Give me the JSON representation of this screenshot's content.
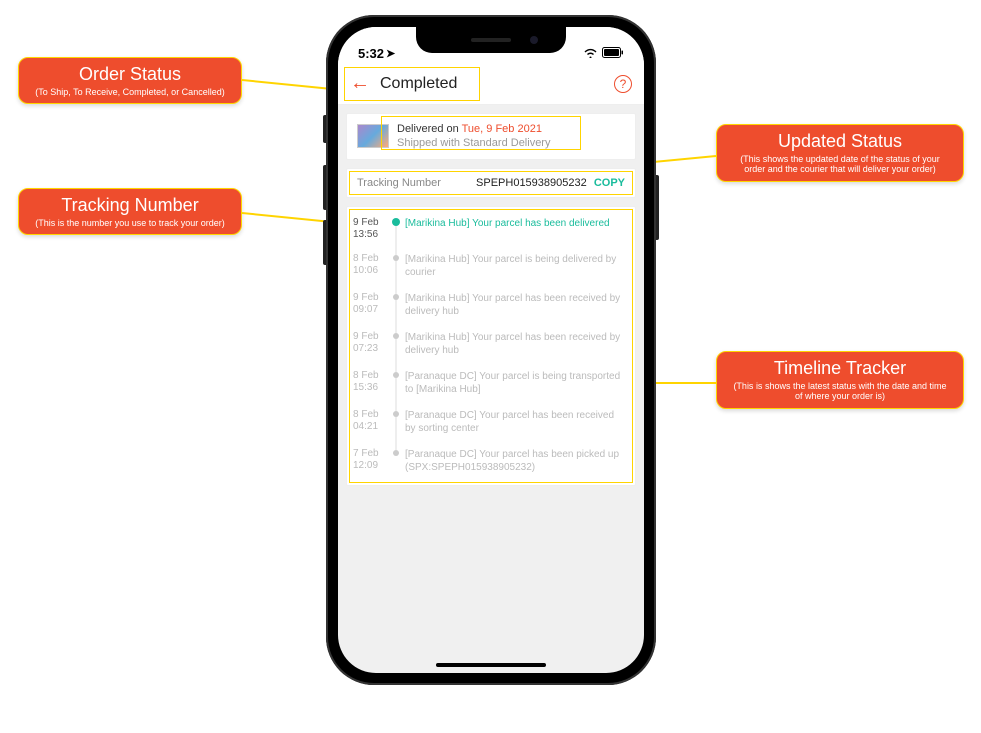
{
  "statusbar": {
    "time": "5:32"
  },
  "header": {
    "title": "Completed"
  },
  "delivered": {
    "prefix": "Delivered on ",
    "date": "Tue, 9 Feb 2021",
    "sub": "Shipped with Standard Delivery"
  },
  "tracking": {
    "label": "Tracking Number",
    "value": "SPEPH015938905232",
    "copy": "COPY"
  },
  "timeline": [
    {
      "date": "9 Feb",
      "time": "13:56",
      "msg": "[Marikina Hub] Your parcel has been delivered",
      "active": true
    },
    {
      "date": "8 Feb",
      "time": "10:06",
      "msg": "[Marikina Hub] Your parcel is being delivered by courier",
      "active": false
    },
    {
      "date": "9 Feb",
      "time": "09:07",
      "msg": "[Marikina Hub] Your parcel has been received by delivery hub",
      "active": false
    },
    {
      "date": "9 Feb",
      "time": "07:23",
      "msg": "[Marikina Hub] Your parcel has been received by delivery hub",
      "active": false
    },
    {
      "date": "8 Feb",
      "time": "15:36",
      "msg": "[Paranaque DC] Your parcel is being transported to [Marikina Hub]",
      "active": false
    },
    {
      "date": "8 Feb",
      "time": "04:21",
      "msg": "[Paranaque DC] Your parcel has been received by sorting center",
      "active": false
    },
    {
      "date": "7 Feb",
      "time": "12:09",
      "msg": "[Paranaque DC] Your parcel has been picked up (SPX:SPEPH015938905232)",
      "active": false
    }
  ],
  "callouts": {
    "orderStatus": {
      "title": "Order Status",
      "desc": "(To Ship, To Receive, Completed, or Cancelled)"
    },
    "trackingNum": {
      "title": "Tracking Number",
      "desc": "(This is the number you use to track your order)"
    },
    "updatedStatus": {
      "title": "Updated Status",
      "desc": "(This shows the updated date of the status of your order and the courier that will deliver your order)"
    },
    "timelineTracker": {
      "title": "Timeline Tracker",
      "desc": "(This is shows the latest status with the date and time of where your order is)"
    }
  }
}
